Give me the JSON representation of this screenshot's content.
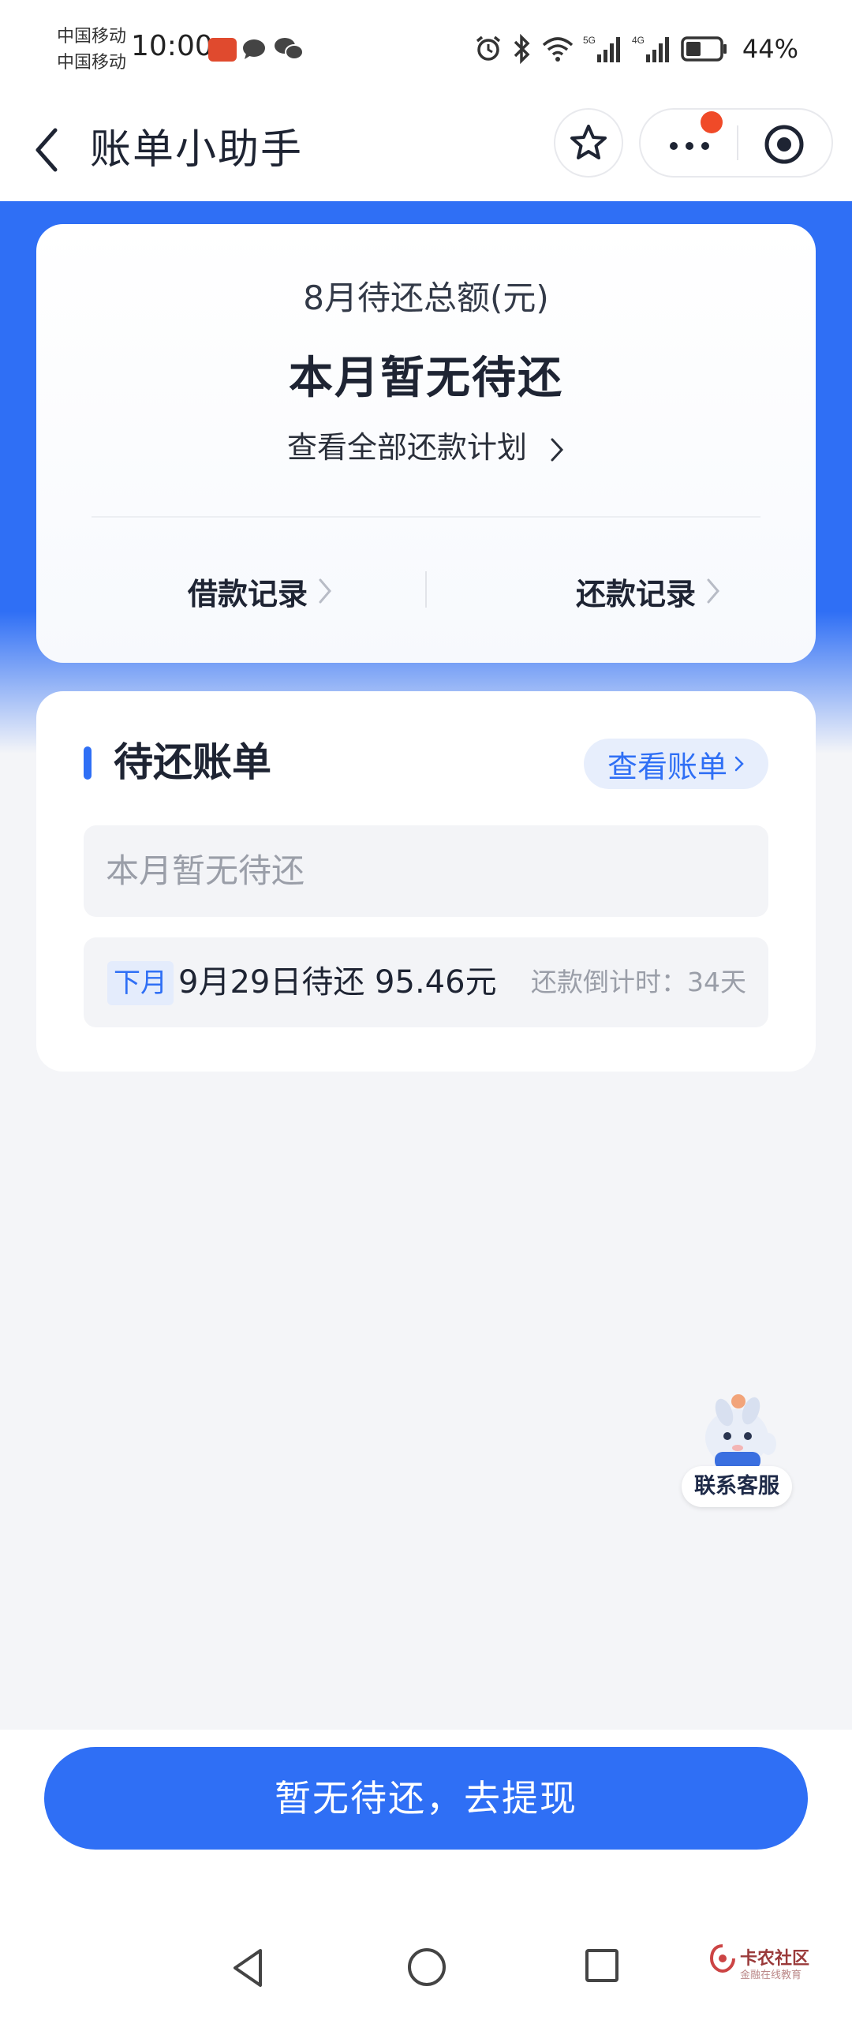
{
  "status_bar": {
    "carrier_1": "中国移动",
    "carrier_2": "中国移动",
    "time": "10:00",
    "battery_text": "44%"
  },
  "nav": {
    "title": "账单小助手"
  },
  "summary": {
    "label": "8月待还总额(元)",
    "amount_text": "本月暂无待还",
    "plan_link": "查看全部还款计划",
    "borrow_records": "借款记录",
    "repay_records": "还款记录"
  },
  "bills": {
    "title": "待还账单",
    "view_bill": "查看账单",
    "empty_text": "本月暂无待还",
    "next_tag": "下月",
    "next_text": "9月29日待还 95.46元",
    "countdown": "还款倒计时：34天"
  },
  "customer_service": {
    "label": "联系客服"
  },
  "cta": {
    "label": "暂无待还，去提现"
  },
  "watermark": {
    "name": "卡农社区",
    "sub": "金融在线教育"
  },
  "colors": {
    "brand_blue": "#2f6ff5",
    "red_dot": "#f04a28"
  }
}
